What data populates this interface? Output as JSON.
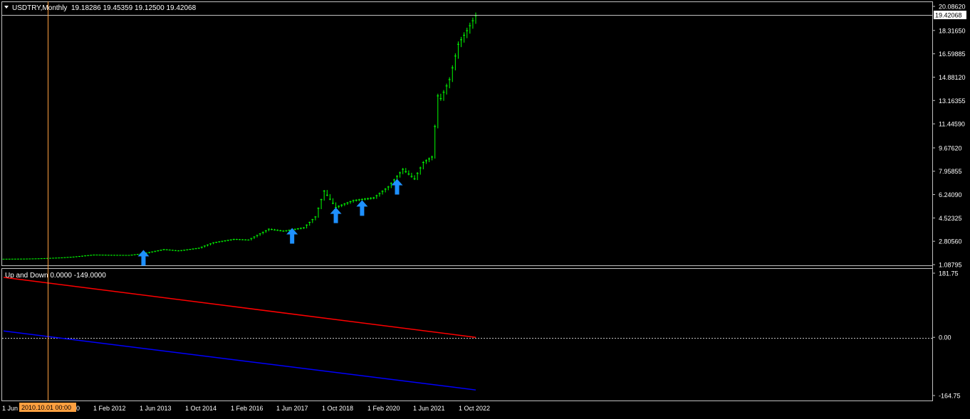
{
  "main_chart": {
    "symbol_label": "USDTRY,Monthly",
    "ohlc_text": "19.18286 19.45359 19.12500 19.42068",
    "current_price_label": "19.42068",
    "price_axis": {
      "ticks": [
        "20.08620",
        "18.31650",
        "16.59885",
        "14.88120",
        "13.16355",
        "11.44590",
        "9.67620",
        "7.95855",
        "6.24090",
        "4.52325",
        "2.80560",
        "1.08795"
      ],
      "min": 1.08795,
      "max": 20.0862
    }
  },
  "indicator": {
    "label": "Up and Down 0.0000 -149.0000",
    "axis_ticks": [
      "181.75",
      "0.00",
      "-164.75"
    ],
    "min": -164.75,
    "max": 181.75,
    "series": [
      {
        "color": "#ff0000",
        "start": 170,
        "end": 0
      },
      {
        "color": "#0000ff",
        "start": 18,
        "end": -149
      }
    ]
  },
  "time_axis": {
    "labels": [
      "1 Jun",
      "2010.10.01 00:00",
      "0",
      "1 Feb 2012",
      "1 Jun 2013",
      "1 Oct 2014",
      "1 Feb 2016",
      "1 Jun 2017",
      "1 Oct 2018",
      "1 Feb 2020",
      "1 Jun 2021",
      "1 Oct 2022"
    ],
    "crosshair_label": "2010.10.01 00:00"
  },
  "colors": {
    "background": "#000000",
    "candle": "#00ff00",
    "arrow": "#1e90ff",
    "grid": "#c0c0c0",
    "crosshair": "#ffa040",
    "text": "#ffffff"
  },
  "chart_data": {
    "type": "line",
    "title": "USDTRY,Monthly",
    "x_range": [
      "2009-06",
      "2022-12"
    ],
    "ylim": [
      1.08795,
      20.0862
    ],
    "series": [
      {
        "name": "USDTRY",
        "points": [
          [
            "2009-06",
            1.49
          ],
          [
            "2010-01",
            1.5
          ],
          [
            "2010-06",
            1.52
          ],
          [
            "2011-01",
            1.58
          ],
          [
            "2011-06",
            1.65
          ],
          [
            "2012-01",
            1.8
          ],
          [
            "2012-06",
            1.78
          ],
          [
            "2013-01",
            1.77
          ],
          [
            "2013-06",
            1.9
          ],
          [
            "2014-01",
            2.2
          ],
          [
            "2014-06",
            2.1
          ],
          [
            "2015-01",
            2.3
          ],
          [
            "2015-06",
            2.7
          ],
          [
            "2016-01",
            2.95
          ],
          [
            "2016-06",
            2.9
          ],
          [
            "2017-01",
            3.7
          ],
          [
            "2017-06",
            3.55
          ],
          [
            "2018-01",
            3.8
          ],
          [
            "2018-05",
            4.6
          ],
          [
            "2018-08",
            6.5
          ],
          [
            "2018-12",
            5.3
          ],
          [
            "2019-06",
            5.8
          ],
          [
            "2020-01",
            6.0
          ],
          [
            "2020-06",
            6.8
          ],
          [
            "2020-11",
            8.1
          ],
          [
            "2021-03",
            7.4
          ],
          [
            "2021-06",
            8.6
          ],
          [
            "2021-09",
            9.0
          ],
          [
            "2021-11",
            13.5
          ],
          [
            "2021-12",
            13.3
          ],
          [
            "2022-03",
            14.7
          ],
          [
            "2022-06",
            17.3
          ],
          [
            "2022-09",
            18.3
          ],
          [
            "2022-12",
            19.4
          ]
        ]
      }
    ],
    "up_arrows": [
      "2013-06",
      "2017-09",
      "2018-12",
      "2019-09",
      "2020-09"
    ]
  }
}
